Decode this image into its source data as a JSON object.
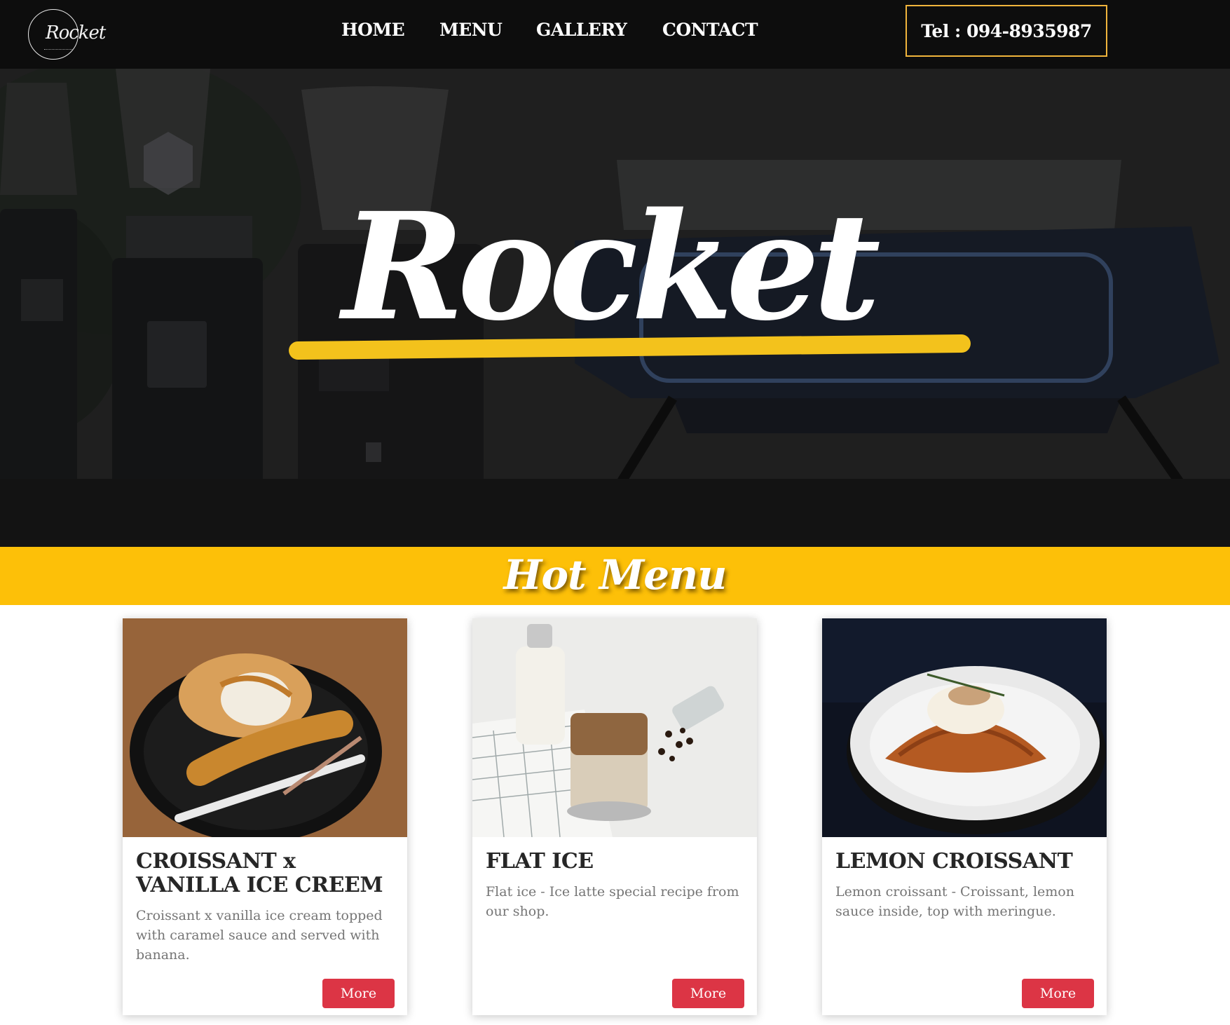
{
  "logo": {
    "text": "Rocket"
  },
  "nav": {
    "home": "HOME",
    "menu": "MENU",
    "gallery": "GALLERY",
    "contact": "CONTACT",
    "tel": "Tel : 094-8935987"
  },
  "hero": {
    "title": "Rocket"
  },
  "hot_menu": {
    "title": "Hot Menu"
  },
  "cards": [
    {
      "title": "CROISSANT x VANILLA ICE CREEM",
      "description": "Croissant x vanilla ice cream topped with caramel sauce and served with banana.",
      "button": "More"
    },
    {
      "title": "FLAT ICE",
      "description": "Flat ice - Ice latte special recipe from our shop.",
      "button": "More"
    },
    {
      "title": "LEMON CROISSANT",
      "description": "Lemon croissant - Croissant, lemon sauce inside, top with meringue.",
      "button": "More"
    }
  ],
  "colors": {
    "navbar": "#0d0d0d",
    "tel_border": "#f0b43c",
    "banner": "#fdc008",
    "hero_underline": "#f3c21c",
    "button": "#dc3545"
  }
}
